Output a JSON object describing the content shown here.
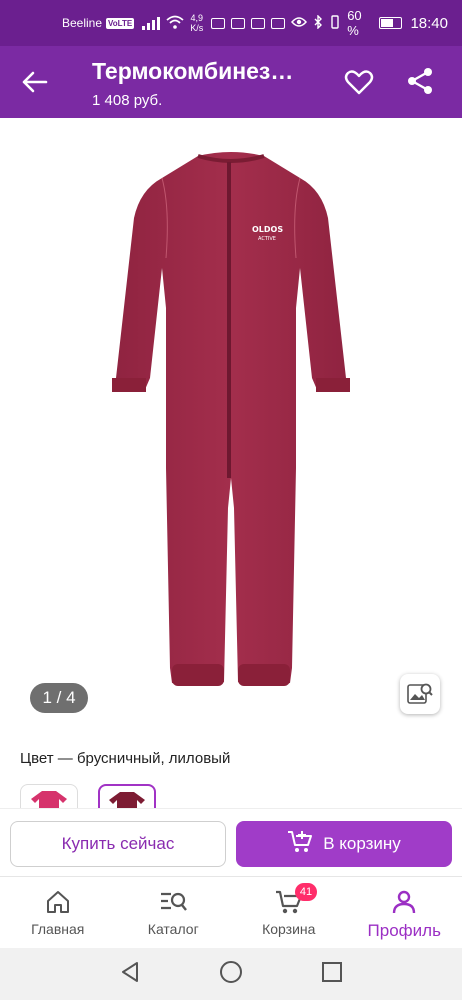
{
  "status": {
    "carrier": "Beeline",
    "volte": "VoLTE",
    "speed_value": "4,9",
    "speed_unit": "K/s",
    "battery": "60 %",
    "time": "18:40"
  },
  "appbar": {
    "title": "Термокомбинез…",
    "price": "1 408 руб."
  },
  "gallery": {
    "counter": "1 / 4",
    "brand_logo": "OLDOS! ACTIVE"
  },
  "color": {
    "label": "Цвет — брусничный, лиловый",
    "swatches": [
      {
        "name": "pink",
        "color": "#d6336c",
        "selected": false
      },
      {
        "name": "burgundy",
        "color": "#7d1c33",
        "selected": true
      }
    ]
  },
  "actions": {
    "buy_now": "Купить сейчас",
    "add_to_cart": "В корзину"
  },
  "nav": {
    "items": [
      {
        "label": "Главная",
        "icon": "home-icon"
      },
      {
        "label": "Каталог",
        "icon": "catalog-icon"
      },
      {
        "label": "Корзина",
        "icon": "cart-icon",
        "badge": "41"
      },
      {
        "label": "Профиль",
        "icon": "profile-icon",
        "active": true
      }
    ]
  },
  "colors": {
    "statusbar": "#6b1f8f",
    "appbar": "#7b2aa3",
    "accent": "#a03cc8",
    "garment": "#9e2a47"
  }
}
